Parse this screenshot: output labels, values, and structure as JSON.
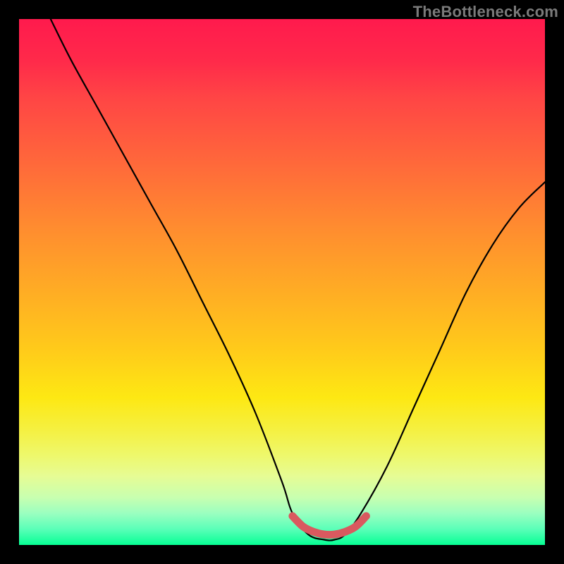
{
  "watermark": "TheBottleneck.com",
  "chart_data": {
    "type": "line",
    "title": "",
    "xlabel": "",
    "ylabel": "",
    "xlim": [
      0,
      100
    ],
    "ylim": [
      0,
      100
    ],
    "curve": {
      "name": "bottleneck",
      "x": [
        6,
        10,
        15,
        20,
        25,
        30,
        35,
        40,
        45,
        50,
        52,
        55,
        58,
        60,
        62,
        65,
        70,
        75,
        80,
        85,
        90,
        95,
        100
      ],
      "y": [
        100,
        92,
        83,
        74,
        65,
        56,
        46,
        36,
        25,
        12,
        6,
        2,
        1,
        1,
        2,
        6,
        15,
        26,
        37,
        48,
        57,
        64,
        69
      ]
    },
    "optimum_band": {
      "name": "optimum",
      "x": [
        52,
        54,
        56,
        58,
        60,
        62,
        64,
        66
      ],
      "y": [
        5.5,
        3.5,
        2.5,
        2.0,
        2.0,
        2.5,
        3.5,
        5.5
      ]
    },
    "gradient_meaning": "top=red=high bottleneck, bottom=green=low bottleneck",
    "grid": false,
    "legend": false
  }
}
